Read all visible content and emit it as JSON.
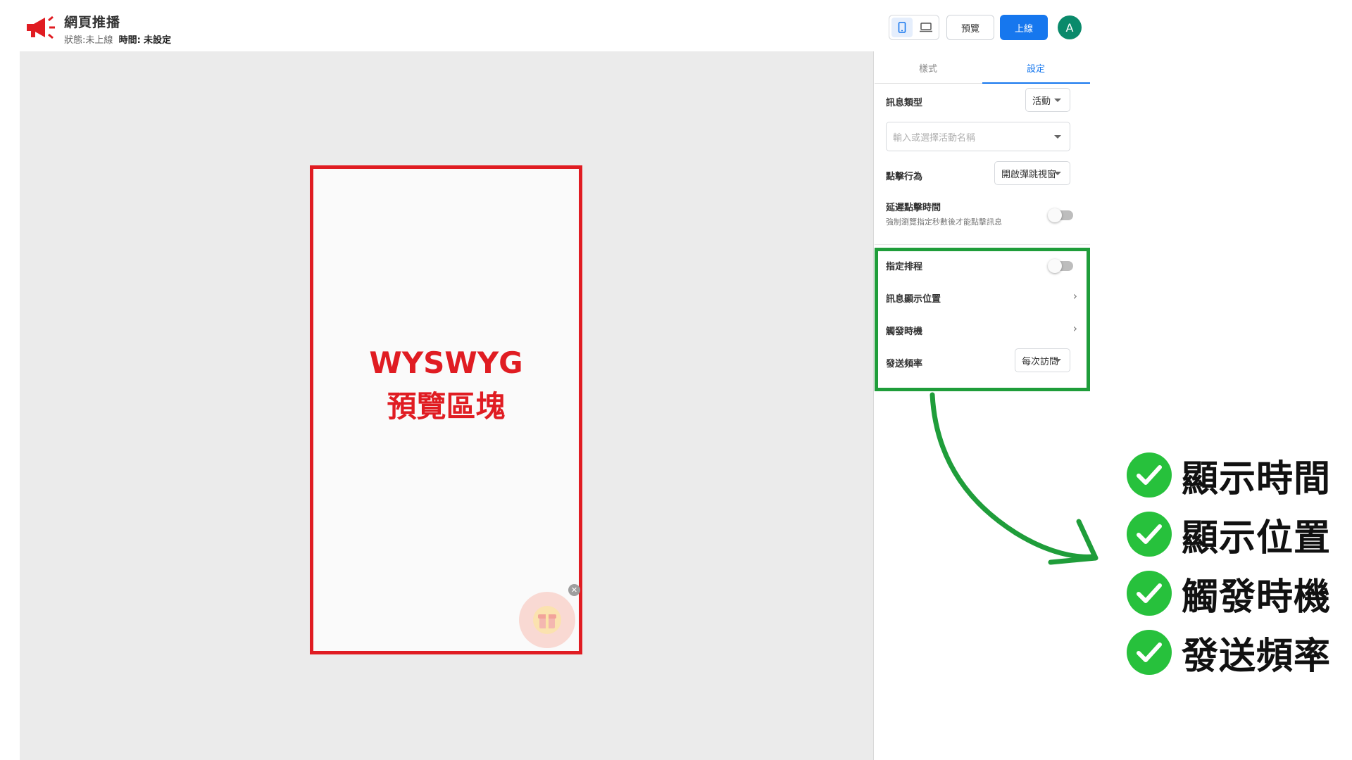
{
  "header": {
    "title": "網頁推播",
    "status_label": "狀態:",
    "status_value": "未上線",
    "time_label": "時間:",
    "time_value": "未設定",
    "preview_label": "預覽",
    "publish_label": "上線",
    "avatar_initial": "A"
  },
  "canvas": {
    "overlay_line1": "WYSWYG",
    "overlay_line2": "預覽區塊"
  },
  "panel": {
    "tabs": [
      {
        "label": "樣式",
        "active": false
      },
      {
        "label": "設定",
        "active": true
      }
    ],
    "message_type_label": "訊息類型",
    "message_type_value": "活動",
    "campaign_placeholder": "輸入或選擇活動名稱",
    "click_action_label": "點擊行為",
    "click_action_value": "開啟彈跳視窗",
    "delay_click_label": "延遲點擊時間",
    "delay_click_desc": "強制瀏覽指定秒數後才能點擊訊息",
    "schedule_label": "指定排程",
    "position_label": "訊息顯示位置",
    "trigger_label": "觸發時機",
    "frequency_label": "發送頻率",
    "frequency_value": "每次訪問"
  },
  "features": [
    "顯示時間",
    "顯示位置",
    "觸發時機",
    "發送頻率"
  ],
  "colors": {
    "accent": "#1677ee",
    "highlight_red": "#e01c22",
    "highlight_green": "#1f9d3a",
    "check_green": "#27c13c",
    "avatar": "#0a8a6b"
  }
}
